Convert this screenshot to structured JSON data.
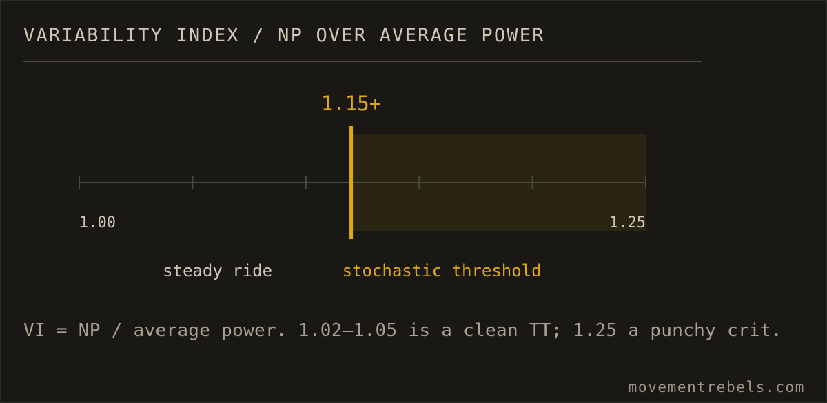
{
  "colors": {
    "background": "#1a1815",
    "accent": "#e0a90f",
    "band": "#2a2413",
    "axis": "#4c4a40",
    "text": "#cfc8b8",
    "muted": "#a8a293"
  },
  "header": {
    "title": "VARIABILITY INDEX / NP OVER AVERAGE POWER"
  },
  "chart_data": {
    "type": "bar",
    "xlim": [
      1.0,
      1.25
    ],
    "ticks": [
      1.0,
      1.05,
      1.1,
      1.15,
      1.2,
      1.25
    ],
    "tick_labels": [
      {
        "value": 1.0,
        "text": "1.00"
      },
      {
        "value": 1.25,
        "text": "1.25"
      }
    ],
    "marker": {
      "value": 1.12,
      "label": "1.15+"
    },
    "highlight_range": [
      1.12,
      1.25
    ],
    "zones": [
      {
        "label": "steady ride",
        "center": 1.061
      },
      {
        "label": "stochastic threshold",
        "center": 1.16
      }
    ],
    "grid": false
  },
  "footer": {
    "note": "VI = NP / average power. 1.02–1.05 is a clean TT; 1.25 a punchy crit.",
    "source": "movementrebels.com"
  }
}
